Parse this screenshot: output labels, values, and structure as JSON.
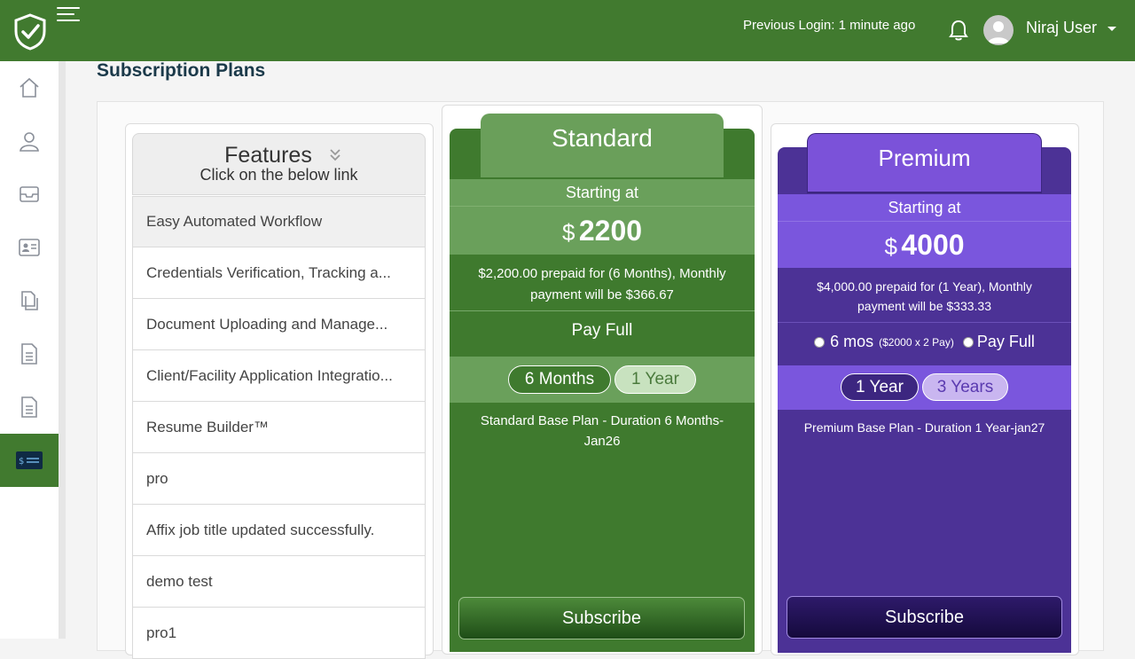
{
  "header": {
    "previous_login": "Previous Login: 1 minute ago",
    "user_name": "Niraj User"
  },
  "page": {
    "title": "Subscription Plans"
  },
  "features": {
    "title": "Features",
    "subtitle": "Click on the below link",
    "items": [
      "Easy Automated Workflow",
      "Credentials Verification, Tracking a...",
      "Document Uploading and Manage...",
      "Client/Facility Application Integratio...",
      "Resume Builder™",
      "pro",
      "Affix job title updated successfully.",
      "demo test",
      "pro1"
    ]
  },
  "standard": {
    "name": "Standard",
    "starting_at": "Starting at",
    "currency": "$",
    "price": "2200",
    "description": "$2,200.00 prepaid for (6 Months), Monthly payment will be $366.67",
    "pay_full": "Pay Full",
    "durations": [
      "6 Months",
      "1 Year"
    ],
    "selected_duration": "6 Months",
    "plan_text": "Standard Base Plan - Duration 6 Months-Jan26",
    "subscribe": "Subscribe"
  },
  "premium": {
    "name": "Premium",
    "starting_at": "Starting at",
    "currency": "$",
    "price": "4000",
    "description": "$4,000.00 prepaid for (1 Year), Monthly payment will be $333.33",
    "option_installment": "6 mos",
    "option_installment_detail": "($2000 x 2 Pay)",
    "option_full": "Pay Full",
    "durations": [
      "1 Year",
      "3 Years"
    ],
    "selected_duration": "1 Year",
    "plan_text": "Premium Base Plan - Duration 1 Year-jan27",
    "subscribe": "Subscribe"
  },
  "sidebar": {
    "items": [
      "home-icon",
      "user-icon",
      "inbox-icon",
      "id-card-icon",
      "documents-icon",
      "file-icon",
      "file-text-icon",
      "billing-icon"
    ],
    "active": "billing-icon"
  },
  "colors": {
    "brand_green": "#417a2f",
    "standard_light": "#6aa05b",
    "premium_dark": "#4c3296",
    "premium_light": "#7a56dd"
  }
}
